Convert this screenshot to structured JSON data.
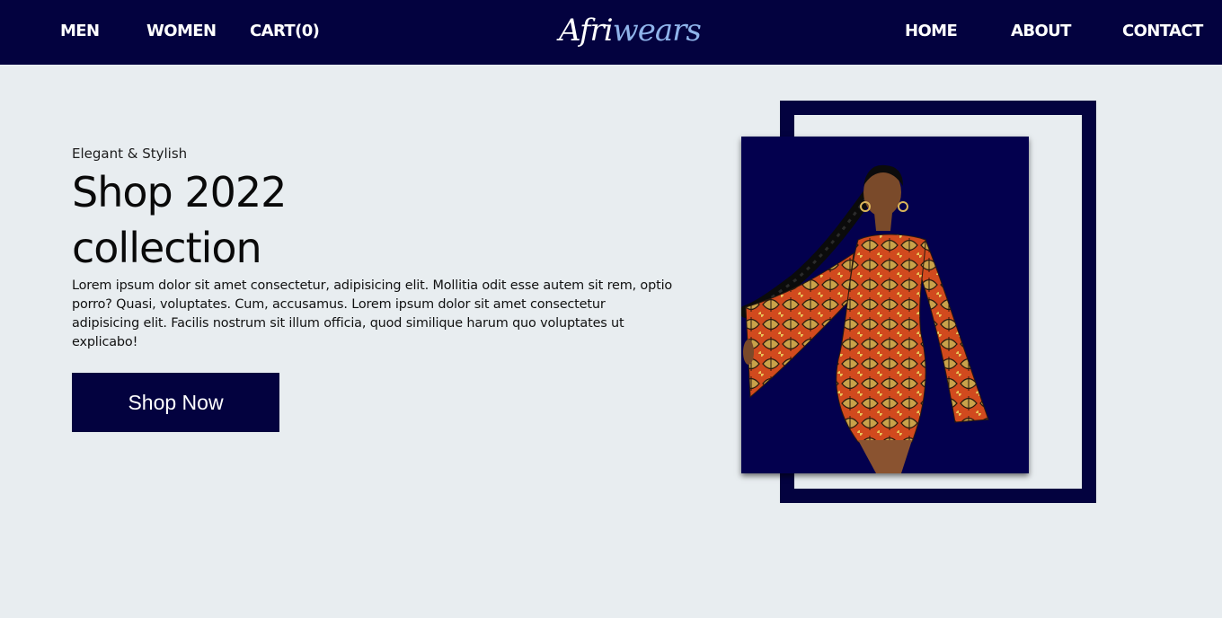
{
  "nav": {
    "left": [
      "MEN",
      "WOMEN",
      "CART(0)"
    ],
    "right": [
      "HOME",
      "ABOUT",
      "CONTACT"
    ]
  },
  "logo": {
    "part1": "Afri",
    "part2": "wears"
  },
  "hero": {
    "tagline": "Elegant & Stylish",
    "headline": "Shop 2022 collection",
    "description": "Lorem ipsum dolor sit amet consectetur, adipisicing elit. Mollitia odit esse autem sit rem, optio porro? Quasi, voluptates. Cum, accusamus. Lorem ipsum dolor sit amet consectetur adipisicing elit. Facilis nostrum sit illum officia, quod similique harum quo voluptates ut explicabo!",
    "button_label": "Shop Now"
  },
  "colors": {
    "navy": "#03023f",
    "page_bg": "#e8edf0",
    "logo_accent": "#8fb4ea",
    "dress": "#d14a1e"
  }
}
